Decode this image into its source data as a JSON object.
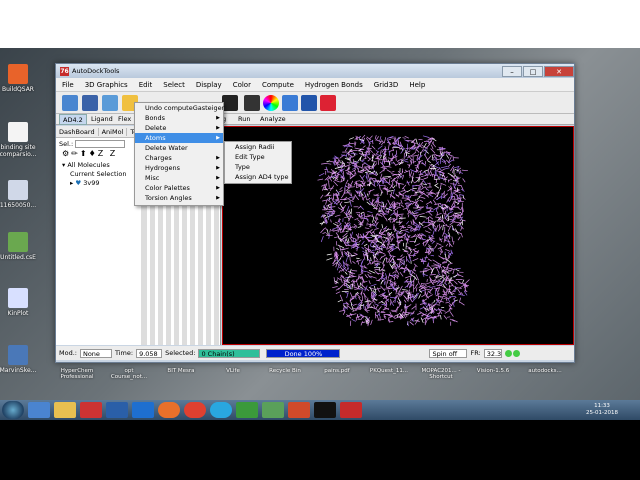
{
  "window": {
    "title": "AutoDockTools",
    "controls": [
      "–",
      "□",
      "✕"
    ]
  },
  "menubar": [
    "File",
    "3D Graphics",
    "Edit",
    "Select",
    "Display",
    "Color",
    "Compute",
    "Hydrogen Bonds",
    "Grid3D",
    "Help"
  ],
  "tabs": {
    "ad42": "AD4.2",
    "ligand": "Ligand",
    "flex": "Flex",
    "g": "g",
    "run": "Run",
    "analyze": "Analyze"
  },
  "left_panel": {
    "tabs": [
      "DashBoard",
      "AniMol",
      "To"
    ],
    "sel_label": "Sel.:",
    "icons": "⚙✏⬆♦Z Z",
    "all_molecules": "All Molecules",
    "current_selection": "Current Selection",
    "molecule": "3v99"
  },
  "edit_menu": [
    {
      "label": "Undo computeGasteiger",
      "sub": false
    },
    {
      "label": "Bonds",
      "sub": true
    },
    {
      "label": "Delete",
      "sub": true
    },
    {
      "label": "Atoms",
      "sub": true,
      "highlighted": true
    },
    {
      "label": "Delete Water",
      "sub": false
    },
    {
      "label": "Charges",
      "sub": true
    },
    {
      "label": "Hydrogens",
      "sub": true
    },
    {
      "label": "Misc",
      "sub": true
    },
    {
      "label": "Color Palettes",
      "sub": true
    },
    {
      "label": "Torsion Angles",
      "sub": true
    }
  ],
  "atoms_submenu": [
    "Assign Radii",
    "Edit Type",
    "Type",
    "Assign AD4 type"
  ],
  "status": {
    "mod_label": "Mod.:",
    "mod_value": "None",
    "time_label": "Time:",
    "time_value": "9.058",
    "selected_label": "Selected:",
    "selected_value": "0 Chain(s)",
    "done": "Done 100%",
    "spin": "Spin off",
    "fr_label": "FR:",
    "fr_value": "32.3"
  },
  "desktop_icons": [
    {
      "label": "BuildQSAR",
      "color": "#e8632a"
    },
    {
      "label": "binding site comparsio...",
      "color": "#f4f4f4"
    },
    {
      "label": "11650050...",
      "color": "#d0d8e8"
    },
    {
      "label": "Untitled.csE",
      "color": "#6aa84f"
    },
    {
      "label": "KinPlot",
      "color": "#d8e0ff"
    },
    {
      "label": "MarvinSke...",
      "color": "#4a78b8"
    }
  ],
  "desktop_icons_col2": [
    "Mole",
    "1.2. D Anti",
    "mukesh",
    "etc",
    "Ma",
    "QSAR",
    "ITR HUF... mukesh.do...",
    "DE"
  ],
  "taskbar_labels": [
    "HyperChem Professional",
    "opt Course_not...",
    "BIT Mesra",
    "VLife",
    "Recycle Bin",
    "pains.pdf",
    "PKQuest_11...",
    "MOPAC201... - Shortcut",
    "Vision-1.5.6",
    "autodocks..."
  ],
  "clock": {
    "time": "11:33",
    "date": "25-01-2018"
  },
  "colors": {
    "accent": "#3f8ee6",
    "viewer_bg": "#000000",
    "protein": "#d58ee8",
    "status_green": "#2fbf9a",
    "status_blue": "#0022cc"
  }
}
